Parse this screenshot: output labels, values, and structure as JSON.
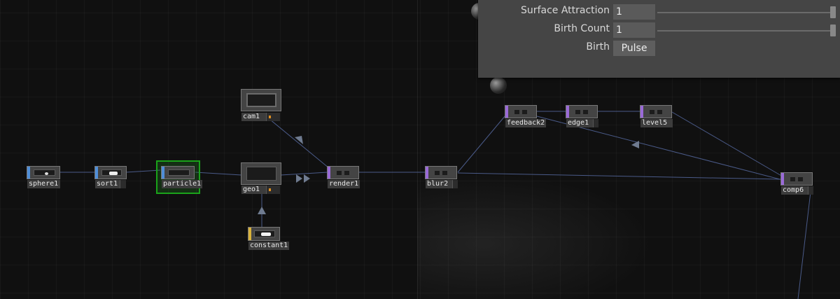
{
  "parameters": {
    "surface_attraction": {
      "label": "Surface Attraction",
      "value": "1",
      "slider_fraction": 1.0
    },
    "birth_count": {
      "label": "Birth Count",
      "value": "1",
      "slider_fraction": 1.0
    },
    "birth": {
      "label": "Birth",
      "button": "Pulse"
    }
  },
  "nodes": [
    {
      "id": "sphere1",
      "label": "sphere1",
      "family": "SOP",
      "color": "#4f8ed8"
    },
    {
      "id": "sort1",
      "label": "sort1",
      "family": "SOP",
      "color": "#4f8ed8"
    },
    {
      "id": "particle1",
      "label": "particle1",
      "family": "SOP",
      "color": "#4f8ed8",
      "selected": true
    },
    {
      "id": "geo1",
      "label": "geo1",
      "family": "COMP",
      "color": "#8a8a8a"
    },
    {
      "id": "cam1",
      "label": "cam1",
      "family": "COMP",
      "color": "#8a8a8a"
    },
    {
      "id": "constant1",
      "label": "constant1",
      "family": "MAT",
      "color": "#d8b23a"
    },
    {
      "id": "render1",
      "label": "render1",
      "family": "TOP",
      "color": "#9a6ad8"
    },
    {
      "id": "blur2",
      "label": "blur2",
      "family": "TOP",
      "color": "#9a6ad8"
    },
    {
      "id": "feedback2",
      "label": "feedback2",
      "family": "TOP",
      "color": "#9a6ad8"
    },
    {
      "id": "edge1",
      "label": "edge1",
      "family": "TOP",
      "color": "#9a6ad8"
    },
    {
      "id": "level5",
      "label": "level5",
      "family": "TOP",
      "color": "#9a6ad8"
    },
    {
      "id": "comp6",
      "label": "comp6",
      "family": "TOP",
      "color": "#9a6ad8"
    }
  ],
  "connections": [
    [
      "sphere1",
      "sort1"
    ],
    [
      "sort1",
      "particle1"
    ],
    [
      "particle1",
      "geo1"
    ],
    [
      "geo1",
      "render1"
    ],
    [
      "cam1",
      "render1"
    ],
    [
      "constant1",
      "geo1"
    ],
    [
      "render1",
      "blur2"
    ],
    [
      "blur2",
      "feedback2"
    ],
    [
      "blur2",
      "comp6"
    ],
    [
      "feedback2",
      "edge1"
    ],
    [
      "edge1",
      "level5"
    ],
    [
      "level5",
      "comp6"
    ],
    [
      "comp6",
      "feedback2"
    ]
  ]
}
